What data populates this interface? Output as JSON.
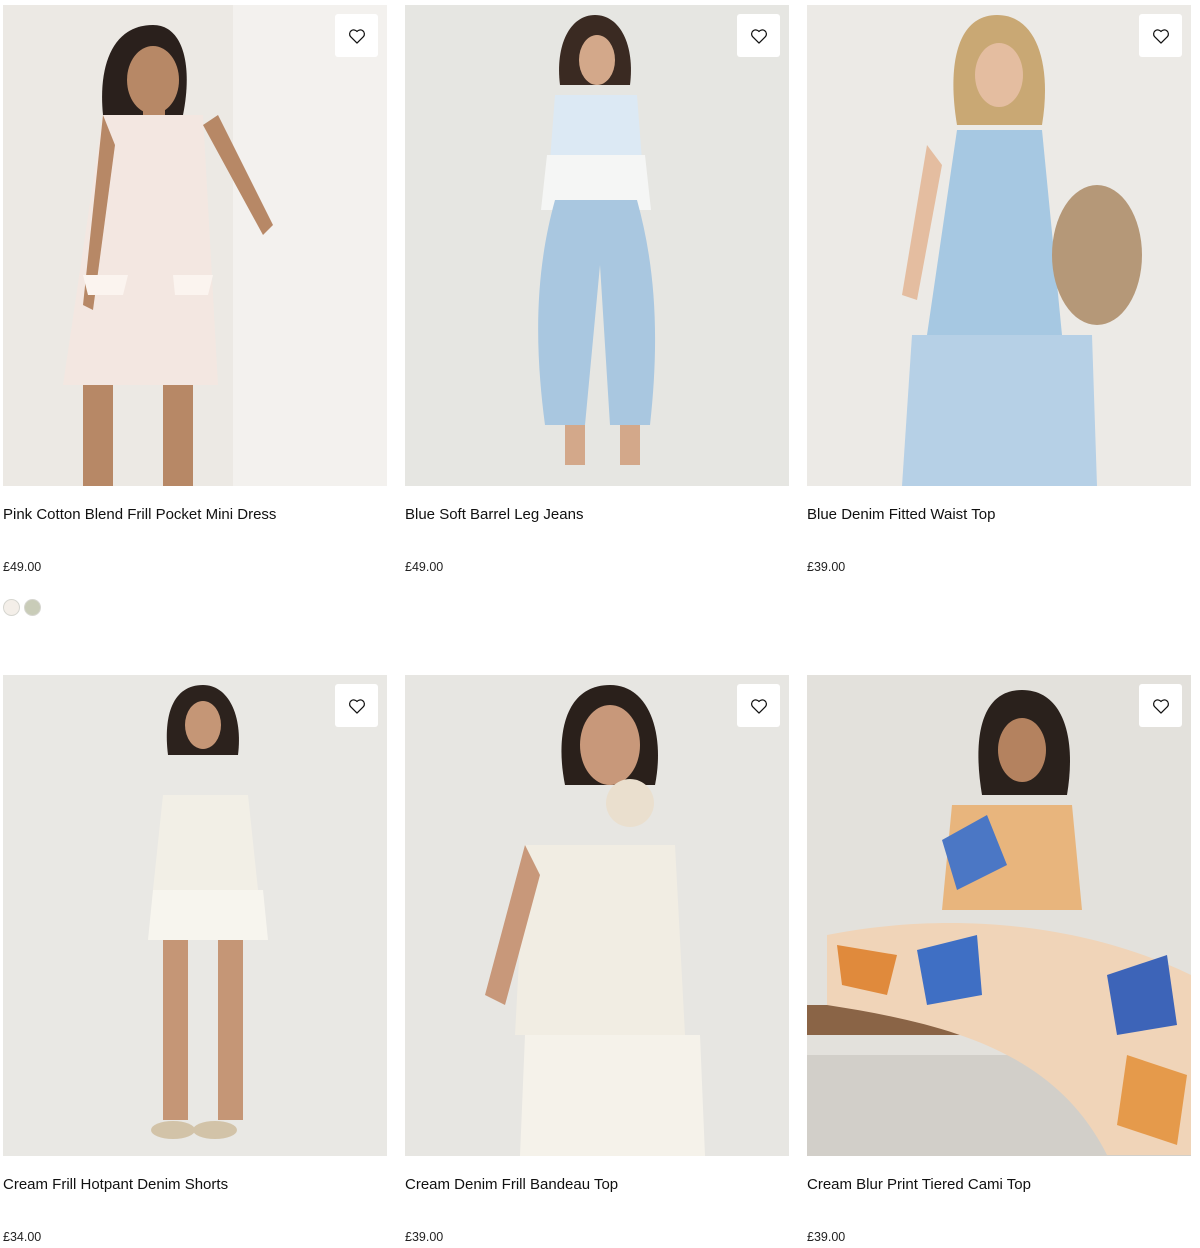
{
  "products": [
    {
      "name": "Pink Cotton Blend Frill Pocket Mini Dress",
      "price": "£49.00",
      "swatch_colors": [
        "#f4efe9",
        "#c9ccb8"
      ],
      "bg": "#ece9e4",
      "garment": "#f3e7e1"
    },
    {
      "name": "Blue Soft Barrel Leg Jeans",
      "price": "£49.00",
      "bg": "#e6e6e2",
      "garment": "#a9c7e0"
    },
    {
      "name": "Blue Denim Fitted Waist Top",
      "price": "£39.00",
      "bg": "#eceae6",
      "garment": "#a6c8e2"
    },
    {
      "name": "Cream Frill Hotpant Denim Shorts",
      "price": "£34.00",
      "bg": "#e9e8e4",
      "garment": "#f2efe6"
    },
    {
      "name": "Cream Denim Frill Bandeau Top",
      "price": "£39.00",
      "bg": "#e7e6e2",
      "garment": "#f1ede3"
    },
    {
      "name": "Cream Blur Print Tiered Cami Top",
      "price": "£39.00",
      "bg": "#e3e1dc",
      "garment": "#e8b57d"
    }
  ],
  "icons": {
    "wishlist": "heart-icon"
  }
}
